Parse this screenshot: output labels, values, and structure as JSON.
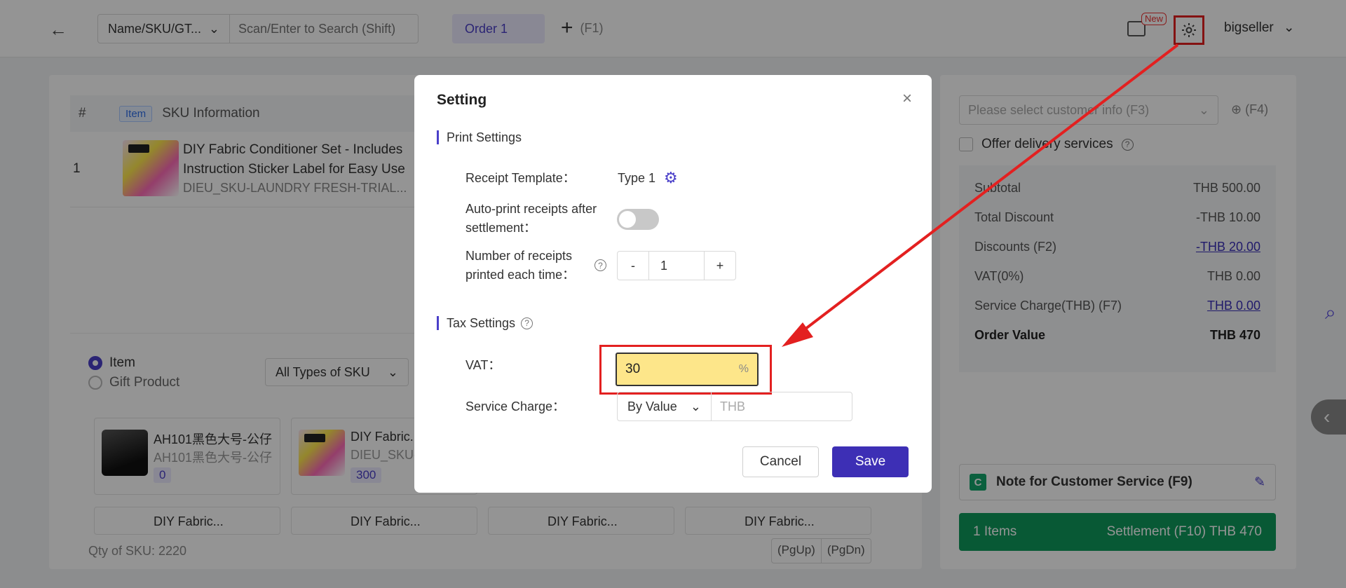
{
  "topbar": {
    "search_type": "Name/SKU/GT...",
    "search_placeholder": "Scan/Enter to Search (Shift)",
    "order_tab": "Order 1",
    "add_order_hint": "(F1)",
    "new_badge": "New",
    "username": "bigseller"
  },
  "order_table": {
    "headers": {
      "num": "#",
      "item_badge": "Item",
      "sku_info": "SKU Information"
    },
    "rows": [
      {
        "num": "1",
        "title": "DIY Fabric Conditioner Set - Includes Instruction Sticker Label for Easy Use",
        "sku": "DIEU_SKU-LAUNDRY FRESH-TRIAL..."
      }
    ]
  },
  "picker": {
    "radio_item": "Item",
    "radio_gift": "Gift Product",
    "sku_type": "All Types of SKU",
    "cards": [
      {
        "title": "AH101黑色大号-公仔",
        "sub": "AH101黑色大号-公仔",
        "qty": "0"
      },
      {
        "title": "DIY Fabric...",
        "sub": "DIEU_SKU-L",
        "qty": "300"
      }
    ],
    "bottom_cards": [
      "DIY Fabric...",
      "DIY Fabric...",
      "DIY Fabric...",
      "DIY Fabric..."
    ],
    "qty_of_sku": "Qty of SKU: 2220",
    "pg_up": "(PgUp)",
    "pg_dn": "(PgDn)"
  },
  "right": {
    "customer_placeholder": "Please select customer info (F3)",
    "customer_add": "(F4)",
    "delivery": "Offer delivery services",
    "summary": [
      {
        "label": "Subtotal",
        "value": "THB 500.00",
        "link": false
      },
      {
        "label": "Total Discount",
        "value": "-THB 10.00",
        "link": false
      },
      {
        "label": "Discounts (F2)",
        "value": "-THB 20.00",
        "link": true
      },
      {
        "label": "VAT(0%)",
        "value": "THB 0.00",
        "link": false
      },
      {
        "label": "Service Charge(THB) (F7)",
        "value": "THB 0.00",
        "link": true
      },
      {
        "label": "Order Value",
        "value": "THB 470",
        "link": false
      }
    ],
    "cs_badge": "C",
    "cs_note": "Note for Customer Service (F9)",
    "items_count": "1 Items",
    "settlement": "Settlement (F10) THB 470"
  },
  "modal": {
    "title": "Setting",
    "print_section": "Print Settings",
    "receipt_template_label": "Receipt Template：",
    "receipt_template_value": "Type 1",
    "auto_print_label": "Auto-print receipts after settlement：",
    "receipts_count_label": "Number of receipts printed each time：",
    "receipts_count_value": "1",
    "minus": "-",
    "plus": "+",
    "tax_section": "Tax Settings",
    "vat_label": "VAT：",
    "vat_value": "30",
    "vat_unit": "%",
    "service_label": "Service Charge：",
    "service_mode": "By Value",
    "service_placeholder": "THB",
    "cancel": "Cancel",
    "save": "Save"
  },
  "colors": {
    "accent": "#4a3fc9",
    "settlement": "#0e9a5c",
    "annotation": "#e32020",
    "highlight": "#fde68a"
  }
}
